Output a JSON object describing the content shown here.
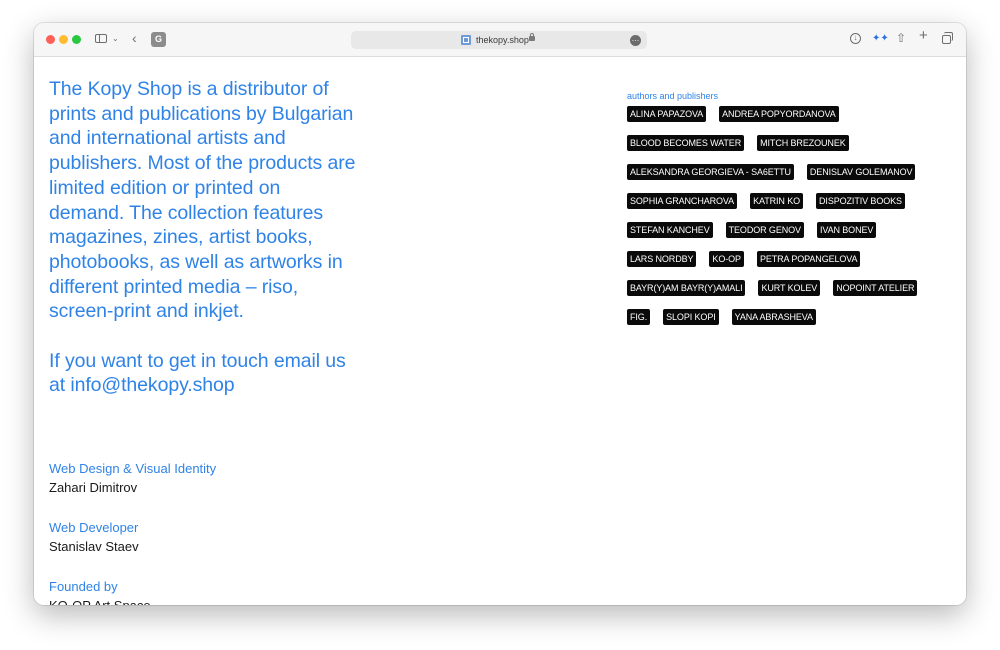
{
  "browser": {
    "url": "thekopy.shop",
    "extension_letter": "G"
  },
  "intro": {
    "paragraph_1": "The Kopy Shop is a distributor of prints and publications by Bulgarian and international artists and publishers. Most of the products are limited edition or printed on demand. The collection features magazines, zines, artist books, photobooks, as well as artworks in different printed media – riso, screen-print and inkjet.",
    "paragraph_2": "If you want to get in touch email us at info@thekopy.shop"
  },
  "credits": [
    {
      "role": "Web Design & Visual Identity",
      "name": "Zahari Dimitrov"
    },
    {
      "role": "Web Developer",
      "name": "Stanislav Staev"
    },
    {
      "role": "Founded by",
      "name": "KO-OP Art Space"
    }
  ],
  "authors": {
    "title": "authors and publishers",
    "items": [
      "ALINA PAPAZOVA",
      "ANDREA POPYORDANOVA",
      "BLOOD BECOMES WATER",
      "MITCH BREZOUNEK",
      "ALEKSANDRA GEORGIEVA - SA6ETTU",
      "DENISLAV GOLEMANOV",
      "SOPHIA GRANCHAROVA",
      "KATRIN KO",
      "DISPOZITIV BOOKS",
      "STEFAN KANCHEV",
      "TEODOR GENOV",
      "IVAN BONEV",
      "LARS NORDBY",
      "KO-OP",
      "PETRA POPANGELOVA",
      "BAYR(Y)AM BAYR(Y)AMALI",
      "KURT KOLEV",
      "NOPOINT ATELIER",
      "FIG.",
      "SLOPI KOPI",
      "YANA ABRASHEVA"
    ]
  },
  "colors": {
    "accent": "#2f83e7",
    "tag_background": "#0a0a0a",
    "tag_text": "#ffffff"
  }
}
